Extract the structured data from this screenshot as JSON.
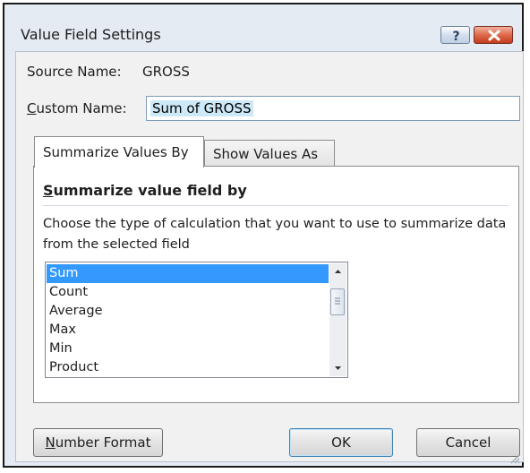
{
  "window": {
    "title": "Value Field Settings",
    "help_icon": "question-mark-icon",
    "close_icon": "close-x-icon"
  },
  "source": {
    "label": "Source Name:",
    "value": "GROSS"
  },
  "custom_name": {
    "label_underlined": "C",
    "label_rest": "ustom Name:",
    "value": "Sum of GROSS"
  },
  "tabs": [
    {
      "label": "Summarize Values By",
      "active": true
    },
    {
      "label": "Show Values As",
      "active": false
    }
  ],
  "summarize": {
    "heading_underlined": "S",
    "heading_rest": "ummarize value field by",
    "description": "Choose the type of calculation that you want to use to summarize data from the selected field",
    "options": [
      "Sum",
      "Count",
      "Average",
      "Max",
      "Min",
      "Product"
    ],
    "selected": "Sum"
  },
  "buttons": {
    "number_format_underlined": "N",
    "number_format_rest": "umber Format",
    "ok": "OK",
    "cancel": "Cancel"
  },
  "colors": {
    "selection": "#3399ff",
    "close_button": "#dd6a4b",
    "frame": "#e5ebf3"
  }
}
